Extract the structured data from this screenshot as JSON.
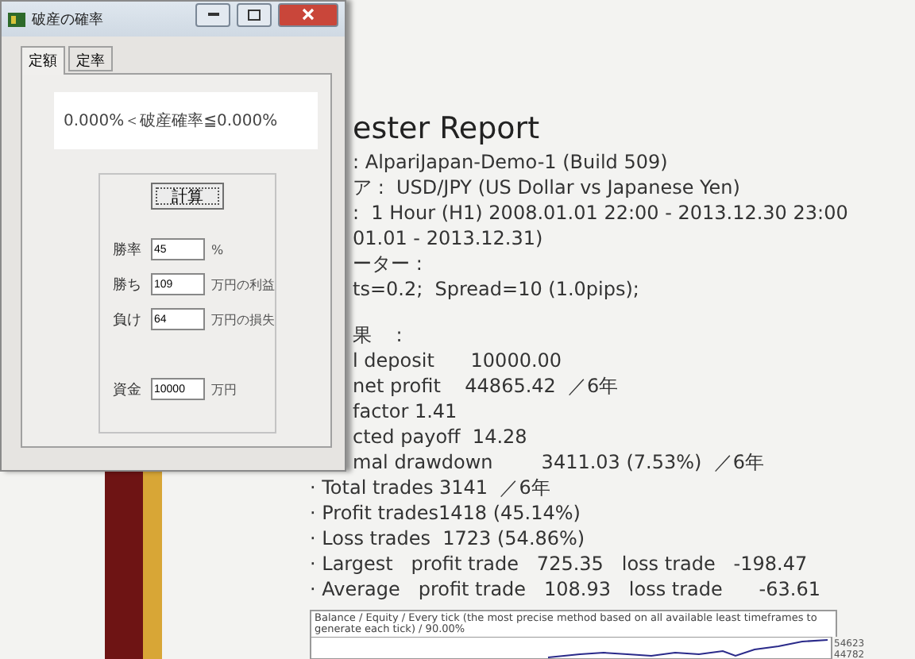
{
  "report": {
    "title": "ester Report",
    "header_lines": [
      ": AlpariJapan-Demo-1 (Build 509)",
      "ア :  USD/JPY (US Dollar vs Japanese Yen)",
      ":  1 Hour (H1) 2008.01.01 22:00 - 2013.12.30 23:00",
      "01.01 - 2013.12.31)",
      "ーター :",
      "ts=0.2;  Spread=10 (1.0pips);"
    ],
    "results_heading": "果    :",
    "results": [
      "l deposit      10000.00",
      "net profit    44865.42  ／6年",
      "factor 1.41",
      "cted payoff  14.28",
      "mal drawdown        3411.03 (7.53%)  ／6年"
    ],
    "stats": [
      "· Total trades 3141  ／6年",
      "· Profit trades1418 (45.14%)",
      "· Loss trades  1723 (54.86%)",
      "· Largest   profit trade   725.35   loss trade   -198.47",
      "· Average   profit trade   108.93   loss trade      -63.61"
    ],
    "chart": {
      "title": "Balance / Equity / Every tick (the most precise method based on all available least timeframes to generate each tick) / 90.00%",
      "axis_labels": [
        "54623",
        "44782"
      ]
    }
  },
  "dialog": {
    "title": "破産の確率",
    "tabs": [
      {
        "label": "定額",
        "selected": true
      },
      {
        "label": "定率",
        "selected": false
      }
    ],
    "result": "0.000%＜破産確率≦0.000%",
    "button": "計算",
    "fields": [
      {
        "label": "勝率",
        "value": "45",
        "unit": "%"
      },
      {
        "label": "勝ち",
        "value": "109",
        "unit": "万円の利益"
      },
      {
        "label": "負け",
        "value": "64",
        "unit": "万円の損失"
      },
      {
        "label": "資金",
        "value": "10000",
        "unit": "万円"
      }
    ]
  }
}
